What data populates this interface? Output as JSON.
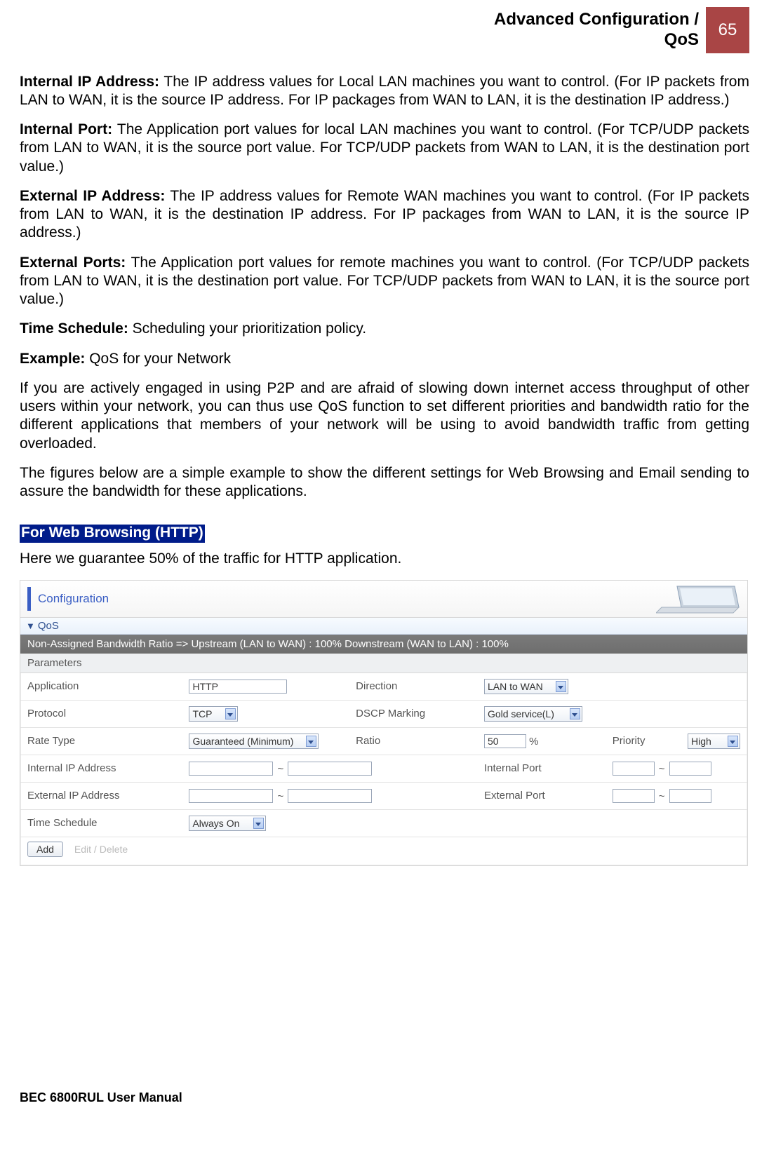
{
  "header": {
    "title_line1": "Advanced Configuration /",
    "title_line2": "QoS",
    "page_number": "65"
  },
  "definitions": [
    {
      "label": "Internal IP Address:",
      "text": " The IP address values for Local LAN machines you want to control. (For IP packets from LAN to WAN, it is the source IP address. For IP packages from WAN to LAN, it is the destination IP address.)"
    },
    {
      "label": "Internal Port:",
      "text": " The Application port values for local LAN machines you want to control. (For TCP/UDP packets from LAN to WAN, it is the source port value. For TCP/UDP packets from WAN to LAN, it is the destination port value.)"
    },
    {
      "label": "External IP Address:",
      "text": " The IP address values for Remote WAN machines you want to control. (For IP packets from LAN to WAN, it is the destination IP address. For IP packages from WAN to LAN, it is the source IP address.)"
    },
    {
      "label": "External Ports:",
      "text": " The Application port values for remote machines you want to control. (For TCP/UDP packets from LAN to WAN, it is the destination port value. For TCP/UDP packets from WAN to LAN, it is the source port value.)"
    },
    {
      "label": "Time Schedule:",
      "text": " Scheduling your prioritization policy."
    },
    {
      "label": "Example:",
      "text": " QoS for your Network"
    }
  ],
  "paragraphs": [
    "If you are actively engaged in using P2P and are afraid of slowing down internet access throughput of other users within your network, you can thus use QoS function to set different priorities and bandwidth ratio for the different applications that members of your network will be using to avoid bandwidth traffic from getting overloaded.",
    "The figures below are a simple example to show the different settings for Web Browsing and Email sending to assure the bandwidth for these applications."
  ],
  "section_badge": "For Web Browsing (HTTP)",
  "section_intro": "Here we guarantee 50% of the traffic for HTTP application.",
  "config": {
    "topbar_title": "Configuration",
    "qos_label": "QoS",
    "band_text": "Non-Assigned Bandwidth Ratio => Upstream (LAN to WAN) : 100%    Downstream (WAN to LAN) : 100%",
    "params_label": "Parameters",
    "labels": {
      "application": "Application",
      "direction": "Direction",
      "protocol": "Protocol",
      "dscp": "DSCP Marking",
      "rate_type": "Rate Type",
      "ratio": "Ratio",
      "priority": "Priority",
      "int_ip": "Internal IP Address",
      "int_port": "Internal Port",
      "ext_ip": "External IP Address",
      "ext_port": "External Port",
      "time": "Time Schedule",
      "percent": "%"
    },
    "values": {
      "application": "HTTP",
      "direction": "LAN to WAN",
      "protocol": "TCP",
      "dscp": "Gold service(L)",
      "rate_type": "Guaranteed (Minimum)",
      "ratio": "50",
      "priority": "High",
      "int_ip_from": "",
      "int_ip_to": "",
      "int_port_from": "",
      "int_port_to": "",
      "ext_ip_from": "",
      "ext_ip_to": "",
      "ext_port_from": "",
      "ext_port_to": "",
      "time": "Always On"
    },
    "buttons": {
      "add": "Add",
      "edit": "Edit / Delete"
    }
  },
  "footer": "BEC 6800RUL User Manual"
}
